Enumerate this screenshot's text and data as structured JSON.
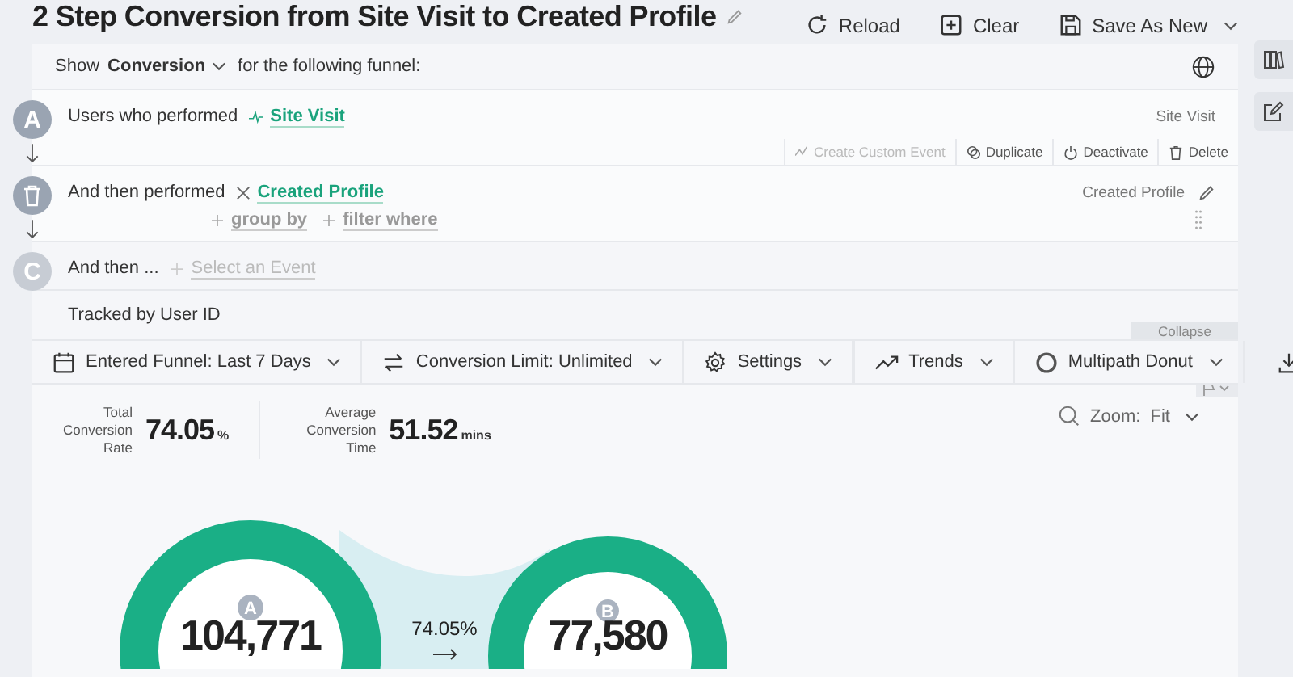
{
  "title": "2 Step Conversion from Site Visit to Created Profile",
  "header_actions": [
    {
      "kind": "reload",
      "label": "Reload"
    },
    {
      "kind": "clear",
      "label": "Clear"
    },
    {
      "kind": "save",
      "label": "Save As New"
    }
  ],
  "filter": {
    "prefix": "Show",
    "metric": "Conversion",
    "suffix": "for the following funnel:"
  },
  "steps": [
    {
      "kind": "letter",
      "letter": "A",
      "lead": "Users who performed",
      "event": "Site Visit",
      "right_label": "Site Visit",
      "actions": [
        "Create Custom Event",
        "Duplicate",
        "Deactivate",
        "Delete"
      ]
    },
    {
      "kind": "trash",
      "lead": "And then performed",
      "event": "Created Profile",
      "right_label": "Created Profile",
      "extras": [
        "group by",
        "filter where"
      ]
    },
    {
      "kind": "letter",
      "letter": "C",
      "lead": "And then ...",
      "placeholder": "Select an Event"
    }
  ],
  "tracked": "Tracked by User ID",
  "collapse": "Collapse",
  "toolbar": [
    {
      "kind": "calendar",
      "label": "Entered Funnel: Last 7 Days"
    },
    {
      "kind": "swap",
      "label": "Conversion Limit: Unlimited"
    },
    {
      "kind": "gear",
      "label": "Settings"
    },
    {
      "kind": "trend",
      "label": "Trends"
    },
    {
      "kind": "ring",
      "label": "Multipath Donut"
    }
  ],
  "stats": [
    {
      "label": "Total Conversion Rate",
      "value": "74.05",
      "unit": "%"
    },
    {
      "label": "Average Conversion Time",
      "value": "51.52",
      "unit": "mins"
    }
  ],
  "zoom": {
    "label": "Zoom:",
    "value": "Fit"
  },
  "donuts": [
    {
      "letter": "A",
      "value": "104,771"
    },
    {
      "letter": "B",
      "value": "77,580"
    }
  ],
  "link_label": "74.05%"
}
